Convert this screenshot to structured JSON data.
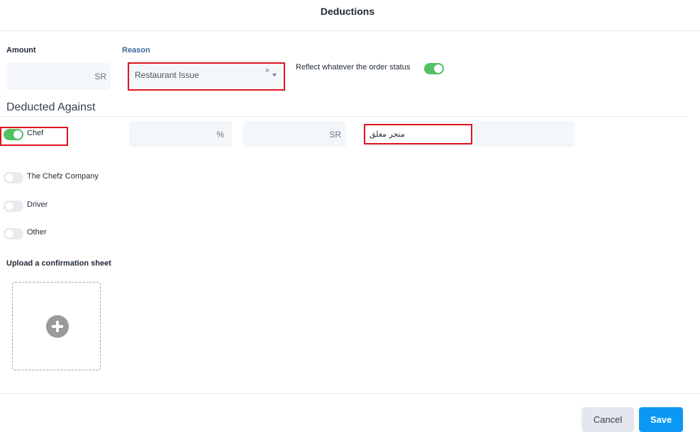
{
  "modal": {
    "title": "Deductions"
  },
  "amount": {
    "label": "Amount",
    "currency": "SR",
    "value": ""
  },
  "reason": {
    "label": "Reason",
    "selected": "Restaurant Issue",
    "clear": "×"
  },
  "reflect": {
    "label": "Reflect whatever the order status",
    "on": true
  },
  "deducted_against": {
    "title": "Deducted Against",
    "options": [
      {
        "label": "Chef",
        "on": true
      },
      {
        "label": "The Chefz Company",
        "on": false
      },
      {
        "label": "Driver",
        "on": false
      },
      {
        "label": "Other",
        "on": false
      }
    ],
    "percent_suffix": "%",
    "amount_suffix": "SR",
    "note": "متجر مغلق"
  },
  "upload": {
    "label": "Upload a confirmation sheet"
  },
  "actions": {
    "cancel": "Cancel",
    "save": "Save"
  },
  "colors": {
    "accent": "#0a98f2",
    "toggle_on": "#52c163",
    "highlight": "#e0131d"
  }
}
